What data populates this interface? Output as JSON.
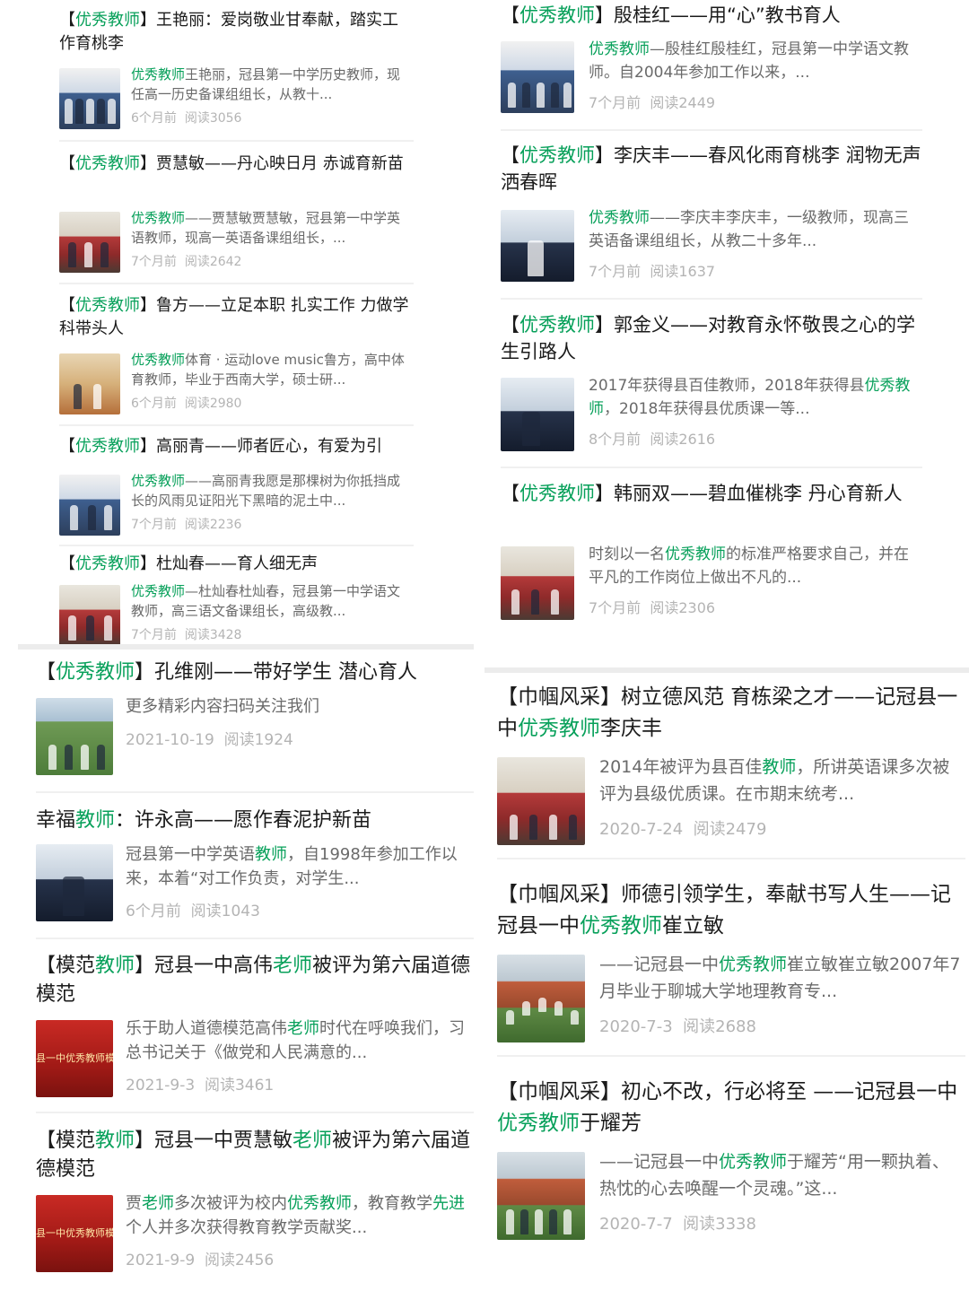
{
  "colors": {
    "highlight": "#07a05a",
    "meta": "#b4b4b4",
    "desc": "#6a6a6a"
  },
  "left_top": [
    {
      "tag": "优秀教师",
      "title": "王艳丽：爱岗敬业甘奉献，踏实工作育桃李",
      "desc_hl": "优秀教师",
      "desc": "王艳丽，冠县第一中学历史教师，现任高一历史备课组组长，从教十...",
      "time": "6个月前",
      "reads": "阅读3056",
      "thumb_icon": "group-photo"
    },
    {
      "tag": "优秀教师",
      "title": "贾慧敏——丹心映日月 赤诚育新苗",
      "desc_hl": "优秀教师",
      "desc": "——贾慧敏贾慧敏，冠县第一中学英语教师，现高一英语备课组组长，...",
      "time": "7个月前",
      "reads": "阅读2642",
      "thumb_icon": "classroom-photo"
    },
    {
      "tag": "优秀教师",
      "title": "鲁方——立足本职 扎实工作 力做学科带头人",
      "desc_hl": "优秀教师",
      "desc": "体育 · 运动love music鲁方，高中体育教师，毕业于西南大学，硕士研...",
      "time": "6个月前",
      "reads": "阅读2980",
      "thumb_icon": "gym-photo"
    },
    {
      "tag": "优秀教师",
      "title": "高丽青——师者匠心，有爱为引",
      "desc_hl": "优秀教师",
      "desc": "——高丽青我愿是那棵树为你抵挡成长的风雨见证阳光下黑暗的泥土中...",
      "time": "7个月前",
      "reads": "阅读2236",
      "thumb_icon": "teacher-photo"
    },
    {
      "tag": "优秀教师",
      "title": "杜灿春——育人细无声",
      "desc_hl": "优秀教师",
      "desc": "—杜灿春杜灿春，冠县第一中学语文教师，高三语文备课组长，高级教...",
      "time": "7个月前",
      "reads": "阅读3428",
      "thumb_icon": "classroom-photo"
    }
  ],
  "right_top": [
    {
      "tag": "优秀教师",
      "title": "殷桂红——用“心”教书育人",
      "desc_hl": "优秀教师",
      "desc_pre": "",
      "desc": "—殷桂红殷桂红，冠县第一中学语文教师。自2004年参加工作以来，...",
      "time": "7个月前",
      "reads": "阅读2449",
      "thumb_icon": "students-photo"
    },
    {
      "tag": "优秀教师",
      "title": "李庆丰——春风化雨育桃李 润物无声洒春晖",
      "desc_hl": "优秀教师",
      "desc_pre": "",
      "desc": "——李庆丰李庆丰，一级教师，现高三英语备课组组长，从教二十多年...",
      "time": "7个月前",
      "reads": "阅读1637",
      "thumb_icon": "teacher-reading-photo"
    },
    {
      "tag": "优秀教师",
      "title": "郭金义——对教育永怀敬畏之心的学生引路人",
      "desc_pre": "2017年获得县百佳教师，2018年获得县",
      "desc_hl": "优秀教师",
      "desc": "，2018年获得县优质课一等...",
      "time": "8个月前",
      "reads": "阅读2616",
      "thumb_icon": "teacher-desk-photo"
    },
    {
      "tag": "优秀教师",
      "title": "韩丽双——碧血催桃李 丹心育新人",
      "desc_pre": "时刻以一名",
      "desc_hl": "优秀教师",
      "desc": "的标准严格要求自己，并在平凡的工作岗位上做出不凡的...",
      "time": "7个月前",
      "reads": "阅读2306",
      "thumb_icon": "classroom-photo"
    }
  ],
  "left_bottom": [
    {
      "title_pre": "【",
      "title_hl": "优秀教师",
      "title_post": "】孔维刚——带好学生 潜心育人",
      "desc_pre": "更多精彩内容扫码关注我们",
      "desc_hl": "",
      "desc": "",
      "time": "2021-10-19",
      "reads": "阅读1924",
      "thumb_icon": "schoolyard-photo"
    },
    {
      "title_pre": "幸福",
      "title_hl": "教师",
      "title_post": "：许永高——愿作春泥护新苗",
      "desc_pre": "冠县第一中学英语",
      "desc_hl": "教师",
      "desc": "，自1998年参加工作以来，本着“对工作负责，对学生...",
      "time": "6个月前",
      "reads": "阅读1043",
      "thumb_icon": "portrait-photo"
    },
    {
      "title_pre": "【模范",
      "title_hl": "教师",
      "title_post": "】冠县一中高伟",
      "title_hl2": "老师",
      "title_post2": "被评为第六届道德模范",
      "desc_pre": "乐于助人道德模范高伟",
      "desc_hl": "老师",
      "desc": "时代在呼唤我们，习总书记关于《做党和人民满意的...",
      "time": "2021-9-3",
      "reads": "阅读3461",
      "thumb_icon": "red-banner",
      "banner_text": "县一中优秀教师模"
    },
    {
      "title_pre": "【模范",
      "title_hl": "教师",
      "title_post": "】冠县一中贾慧敏",
      "title_hl2": "老师",
      "title_post2": "被评为第六届道德模范",
      "desc_pre": "贾",
      "desc_hl": "老师",
      "desc": "多次被评为校内",
      "desc_hl2": "优秀教师",
      "desc2": "，教育教学",
      "desc_hl3": "先进",
      "desc3": "个人并多次获得教育教学贡献奖...",
      "time": "2021-9-9",
      "reads": "阅读2456",
      "thumb_icon": "red-banner",
      "banner_text": "县一中优秀教师模"
    }
  ],
  "right_bottom": [
    {
      "title_pre": "【巾帼风采】树立德风范 育栋梁之才——记冠县一中",
      "title_hl": "优秀教师",
      "title_post": "李庆丰",
      "desc_pre": "2014年被评为县百佳",
      "desc_hl": "教师",
      "desc": "，所讲英语课多次被评为县级优质课。在市期末统考...",
      "time": "2020-7-24",
      "reads": "阅读2479",
      "thumb_icon": "classroom-photo"
    },
    {
      "title_pre": "【巾帼风采】师德引领学生，奉献书写人生——记冠县一中",
      "title_hl": "优秀教师",
      "title_post": "崔立敏",
      "desc_pre": "——记冠县一中",
      "desc_hl": "优秀教师",
      "desc": "崔立敏崔立敏2007年7月毕业于聊城大学地理教育专...",
      "time": "2020-7-3",
      "reads": "阅读2688",
      "thumb_icon": "track-circle-photo"
    },
    {
      "title_pre": "【巾帼风采】初心不改，行必将至 ——记冠县一中",
      "title_hl": "优秀教师",
      "title_post": "于耀芳",
      "desc_pre": "——记冠县一中",
      "desc_hl": "优秀教师",
      "desc": "于耀芳“用一颗执着、热忱的心去唤醒一个灵魂。”这...",
      "time": "2020-7-7",
      "reads": "阅读3338",
      "thumb_icon": "group-field-photo"
    }
  ]
}
